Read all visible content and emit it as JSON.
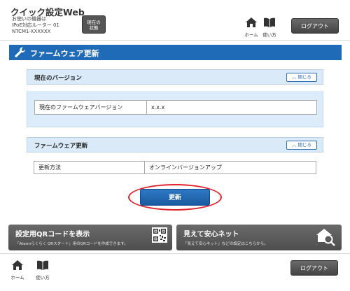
{
  "header": {
    "app_title": "クイック設定Web",
    "device_line1": "お使いの機器は",
    "device_line2": "IPoE対応ルーター 01",
    "device_line3": "NTCM1-XXXXXX",
    "status_button_line1": "現在の",
    "status_button_line2": "状態",
    "home_label": "ホーム",
    "manual_label": "使い方",
    "logout_label": "ログアウト"
  },
  "section": {
    "title": "ファームウェア更新"
  },
  "current_version_panel": {
    "title": "現在のバージョン",
    "close_label": "閉じる",
    "row_label": "現在のファームウェアバージョン",
    "row_value": "x.x.x"
  },
  "firmware_update_panel": {
    "title": "ファームウェア更新",
    "close_label": "閉じる",
    "row_label": "更新方法",
    "row_value": "オンラインバージョンアップ"
  },
  "update_button_label": "更新",
  "banners": {
    "qr": {
      "title": "設定用QRコードを表示",
      "desc": "「Atermらくらく QRスタート」用のQRコードを作成できます。"
    },
    "safety": {
      "title": "見えて安心ネット",
      "desc": "「見えて安心ネット」などの設定はこちらから。"
    }
  },
  "footer": {
    "home_label": "ホーム",
    "manual_label": "使い方",
    "logout_label": "ログアウト"
  },
  "colors": {
    "accent": "#1f6bb8",
    "panel_bg": "#dcecfb",
    "highlight_ring": "#e0222a",
    "banner_bg": "#5a5a5a"
  }
}
